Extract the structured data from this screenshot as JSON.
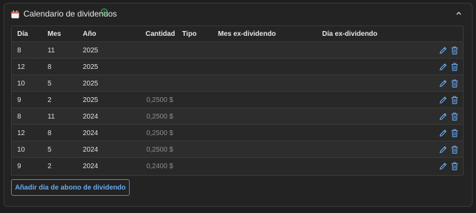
{
  "panel": {
    "title": "Calendario de dividendos",
    "icons": {
      "calendar": "calendar-icon",
      "info": "info-icon",
      "collapse": "chevron-up-icon"
    }
  },
  "table": {
    "headers": {
      "day": "Día",
      "month": "Mes",
      "year": "Año",
      "amount": "Cantidad",
      "type": "Tipo",
      "ex_month": "Mes ex-dividendo",
      "ex_day": "Día ex-dividendo"
    },
    "rows": [
      {
        "day": "8",
        "month": "11",
        "year": "2025",
        "amount": ""
      },
      {
        "day": "12",
        "month": "8",
        "year": "2025",
        "amount": ""
      },
      {
        "day": "10",
        "month": "5",
        "year": "2025",
        "amount": ""
      },
      {
        "day": "9",
        "month": "2",
        "year": "2025",
        "amount": "0,2500 $"
      },
      {
        "day": "8",
        "month": "11",
        "year": "2024",
        "amount": "0,2500 $"
      },
      {
        "day": "12",
        "month": "8",
        "year": "2024",
        "amount": "0,2500 $"
      },
      {
        "day": "10",
        "month": "5",
        "year": "2024",
        "amount": "0,2500 $"
      },
      {
        "day": "9",
        "month": "2",
        "year": "2024",
        "amount": "0,2400 $"
      }
    ],
    "row_actions": [
      "edit-icon",
      "trash-icon"
    ]
  },
  "add_button": {
    "label": "Añadir día de abono de dividendo"
  },
  "colors": {
    "accent": "#4a90d9",
    "info": "#3fb86b",
    "calendar_red": "#d9534f"
  }
}
